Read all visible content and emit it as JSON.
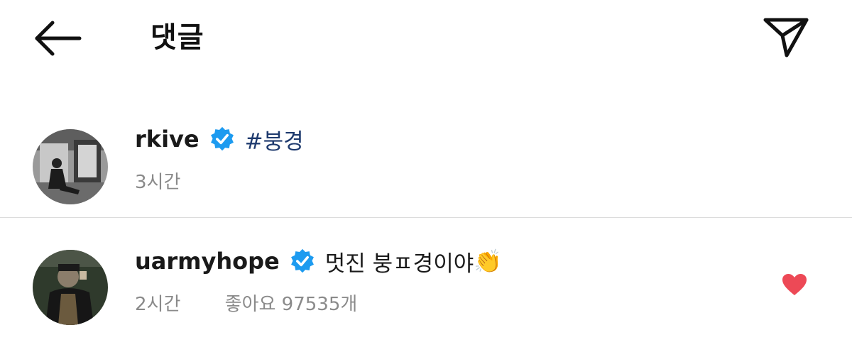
{
  "header": {
    "title": "댓글",
    "back_icon": "arrow-left-icon",
    "send_icon": "paper-plane-icon"
  },
  "comments": [
    {
      "username": "rkive",
      "verified": true,
      "text": "#붕경",
      "time": "3시간",
      "likes": ""
    },
    {
      "username": "uarmyhope",
      "verified": true,
      "text": "멋진 붕ㅍ경이야",
      "emoji": "👏",
      "time": "2시간",
      "likes": "좋아요 97535개",
      "liked": true
    }
  ],
  "colors": {
    "verified": "#1d9bf0",
    "heart": "#ed4956",
    "hashtag": "#1e3a6e",
    "meta": "#8a8a8a"
  }
}
